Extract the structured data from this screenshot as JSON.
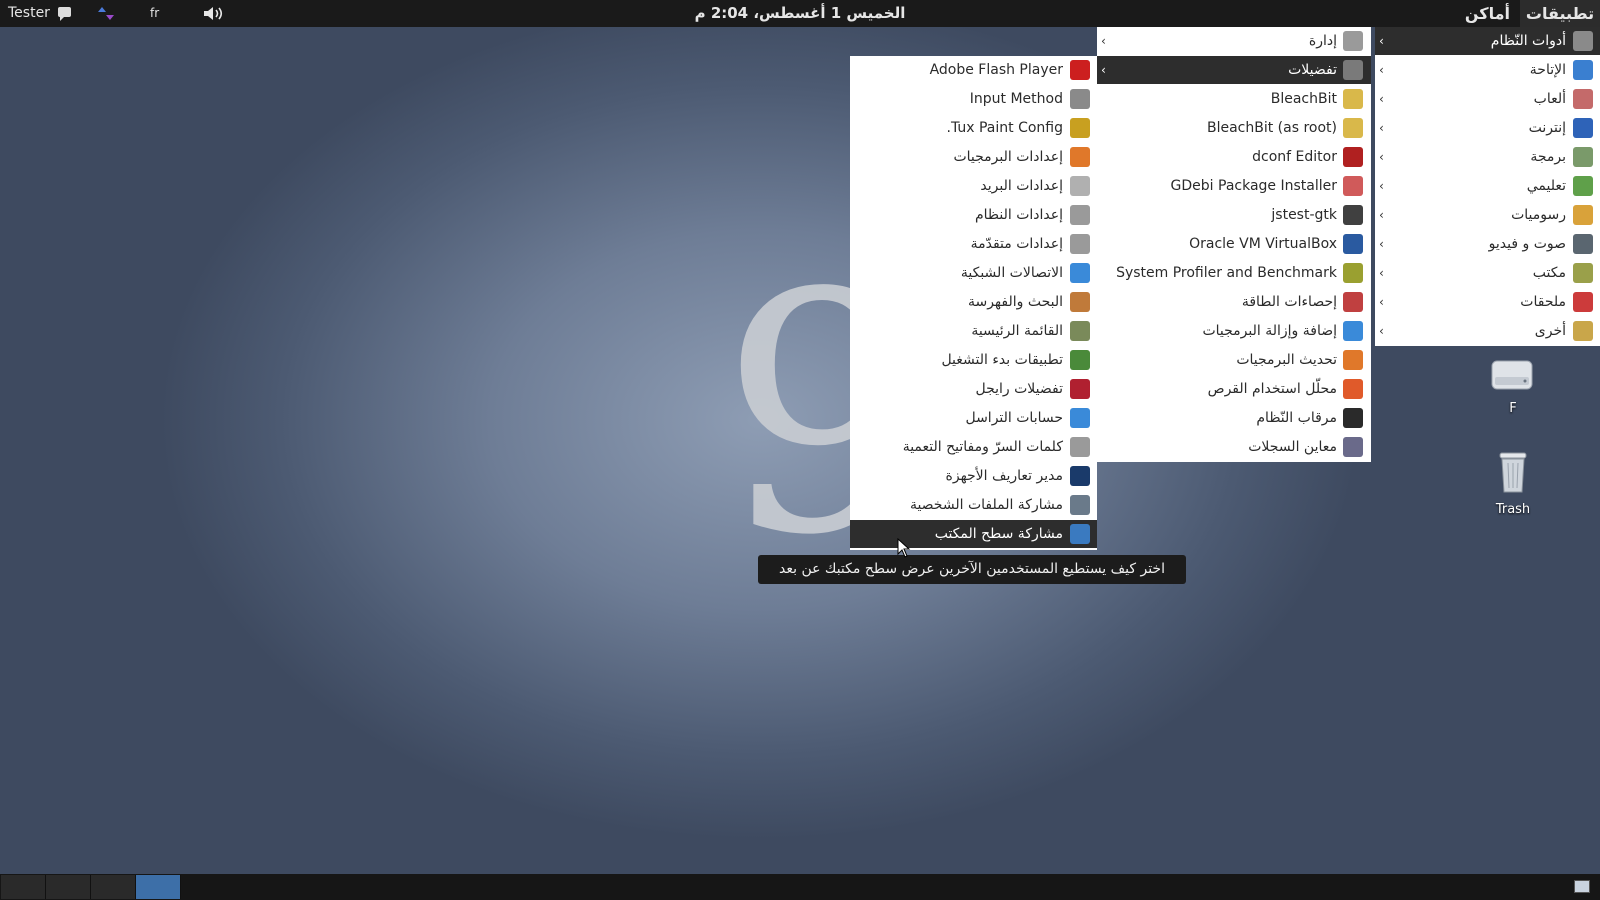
{
  "top_panel": {
    "user": "Tester",
    "keyboard_layout": "fr",
    "clock": "الخميس 1 أغسطس، 2:04 م",
    "places": "أماكن",
    "applications": "تطبيقات"
  },
  "menu_categories": [
    {
      "label": "أدوات النّظام",
      "icon": "gear-icon",
      "color": "#8a8a8a",
      "active": true
    },
    {
      "label": "الإتاحة",
      "icon": "accessibility-icon",
      "color": "#3a7fd0"
    },
    {
      "label": "ألعاب",
      "icon": "games-icon",
      "color": "#c46a6a"
    },
    {
      "label": "إنترنت",
      "icon": "globe-icon",
      "color": "#2e63b8"
    },
    {
      "label": "برمجة",
      "icon": "programming-icon",
      "color": "#7a9a6a"
    },
    {
      "label": "تعليمي",
      "icon": "education-icon",
      "color": "#5fa04a"
    },
    {
      "label": "رسوميات",
      "icon": "graphics-icon",
      "color": "#d9a23a"
    },
    {
      "label": "صوت و فيديو",
      "icon": "multimedia-icon",
      "color": "#5a6670"
    },
    {
      "label": "مكتب",
      "icon": "office-icon",
      "color": "#9aa04a"
    },
    {
      "label": "ملحقات",
      "icon": "accessories-icon",
      "color": "#cc3b3b"
    },
    {
      "label": "أخرى",
      "icon": "other-icon",
      "color": "#c9a64a"
    }
  ],
  "system_tools_items": [
    {
      "label": "إدارة",
      "icon": "administration-icon",
      "color": "#9a9a9a",
      "submenu": true
    },
    {
      "label": "تفضيلات",
      "icon": "preferences-icon",
      "color": "#7a7a7a",
      "submenu": true,
      "active": true
    },
    {
      "label": "BleachBit",
      "icon": "broom-icon",
      "color": "#d9b84a"
    },
    {
      "label": "BleachBit (as root)",
      "icon": "broom-icon",
      "color": "#d9b84a"
    },
    {
      "label": "dconf Editor",
      "icon": "dconf-icon",
      "color": "#b02020"
    },
    {
      "label": "GDebi Package Installer",
      "icon": "package-icon",
      "color": "#d05a5a"
    },
    {
      "label": "jstest-gtk",
      "icon": "joystick-icon",
      "color": "#404040"
    },
    {
      "label": "Oracle VM VirtualBox",
      "icon": "virtualbox-icon",
      "color": "#2a5aa0"
    },
    {
      "label": "System Profiler and Benchmark",
      "icon": "profiler-icon",
      "color": "#9aa030"
    },
    {
      "label": "إحصاءات الطاقة",
      "icon": "power-stats-icon",
      "color": "#c04040"
    },
    {
      "label": "إضافة وإزالة البرمجيات",
      "icon": "add-remove-icon",
      "color": "#3a8ad9"
    },
    {
      "label": "تحديث البرمجيات",
      "icon": "update-icon",
      "color": "#e0782a"
    },
    {
      "label": "محلّل استخدام القرص",
      "icon": "disk-usage-icon",
      "color": "#e05a2a"
    },
    {
      "label": "مرقاب النّظام",
      "icon": "system-monitor-icon",
      "color": "#2a2a2a"
    },
    {
      "label": "معاين السجلات",
      "icon": "log-viewer-icon",
      "color": "#6a6a8a"
    }
  ],
  "preferences_items": [
    {
      "label": "Adobe Flash Player",
      "icon": "flash-icon",
      "color": "#cc1f1f"
    },
    {
      "label": "Input Method",
      "icon": "keyboard-icon",
      "color": "#8a8a8a"
    },
    {
      "label": "Tux Paint Config.",
      "icon": "tuxpaint-icon",
      "color": "#c8a020"
    },
    {
      "label": "إعدادات البرمجيات",
      "icon": "software-settings-icon",
      "color": "#e0782a"
    },
    {
      "label": "إعدادات البريد",
      "icon": "mail-settings-icon",
      "color": "#b0b0b0"
    },
    {
      "label": "إعدادات النظام",
      "icon": "system-settings-icon",
      "color": "#9a9a9a"
    },
    {
      "label": "إعدادات متقدّمة",
      "icon": "advanced-settings-icon",
      "color": "#9a9a9a"
    },
    {
      "label": "الاتصالات الشبكية",
      "icon": "wifi-icon",
      "color": "#3a8ad9"
    },
    {
      "label": "البحث والفهرسة",
      "icon": "search-index-icon",
      "color": "#c07a3a"
    },
    {
      "label": "القائمة الرئيسية",
      "icon": "main-menu-icon",
      "color": "#7a8a5a"
    },
    {
      "label": "تطبيقات بدء التشغيل",
      "icon": "startup-apps-icon",
      "color": "#4a8a3a"
    },
    {
      "label": "تفضيلات رايجل",
      "icon": "remmina-icon",
      "color": "#b02030"
    },
    {
      "label": "حسابات التراسل",
      "icon": "chat-accounts-icon",
      "color": "#3a8ad9"
    },
    {
      "label": "كلمات السرّ ومفاتيح التعمية",
      "icon": "keys-icon",
      "color": "#9a9a9a"
    },
    {
      "label": "مدير تعاريف الأجهزة",
      "icon": "driver-manager-icon",
      "color": "#1a3a6a"
    },
    {
      "label": "مشاركة الملفات الشخصية",
      "icon": "file-sharing-icon",
      "color": "#6a7a8a"
    },
    {
      "label": "مشاركة سطح المكتب",
      "icon": "desktop-sharing-icon",
      "color": "#3a7ac0",
      "active": true
    }
  ],
  "tooltip": "اختر كيف يستطيع المستخدمين الآخرين عرض سطح مكتبك عن بعد",
  "desktop_icons": {
    "drive": "F",
    "trash": "Trash"
  },
  "submenu_arrow": "›",
  "watermark": "9"
}
